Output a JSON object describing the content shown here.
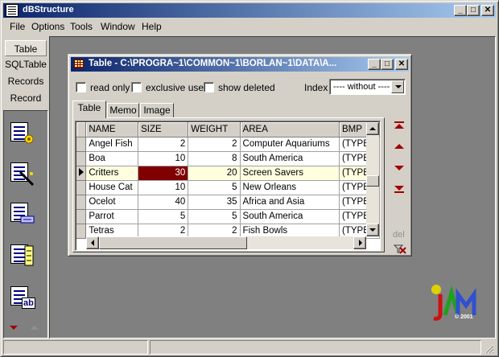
{
  "app": {
    "title": "dBStructure"
  },
  "menu": [
    "File",
    "Options",
    "Tools",
    "Window",
    "Help"
  ],
  "left_tabs": [
    "Table",
    "SQLTable",
    "Records",
    "Record"
  ],
  "left_tools": [
    {
      "icon": "table-properties-icon"
    },
    {
      "icon": "table-search-icon"
    },
    {
      "icon": "table-link-icon"
    },
    {
      "icon": "table-structure-icon"
    },
    {
      "icon": "table-text-icon",
      "badge": "ab"
    }
  ],
  "child": {
    "title": "Table - C:\\PROGRA~1\\COMMON~1\\BORLAN~1\\DATA\\A...",
    "options": [
      "read only",
      "exclusive use",
      "show deleted"
    ],
    "index_label": "Index",
    "index_value": "---- without ----",
    "tabs": [
      "Table",
      "Memo",
      "Image"
    ],
    "del_label": "del"
  },
  "grid": {
    "columns": [
      "NAME",
      "SIZE",
      "WEIGHT",
      "AREA",
      "BMP"
    ],
    "rows": [
      [
        "Angel Fish",
        "2",
        "2",
        "Computer Aquariums",
        "(TYPED"
      ],
      [
        "Boa",
        "10",
        "8",
        "South America",
        "(TYPED"
      ],
      [
        "Critters",
        "30",
        "20",
        "Screen Savers",
        "(TYPED"
      ],
      [
        "House Cat",
        "10",
        "5",
        "New Orleans",
        "(TYPED"
      ],
      [
        "Ocelot",
        "40",
        "35",
        "Africa and Asia",
        "(TYPED"
      ],
      [
        "Parrot",
        "5",
        "5",
        "South America",
        "(TYPED"
      ],
      [
        "Tetras",
        "2",
        "2",
        "Fish Bowls",
        "(TYPED"
      ]
    ],
    "current_row": 2
  },
  "logo": {
    "text": "jam",
    "copyright": "© 2001"
  },
  "colors": {
    "titlebar": "#0a246a",
    "accent": "#800000",
    "navigator": "#a00000"
  }
}
